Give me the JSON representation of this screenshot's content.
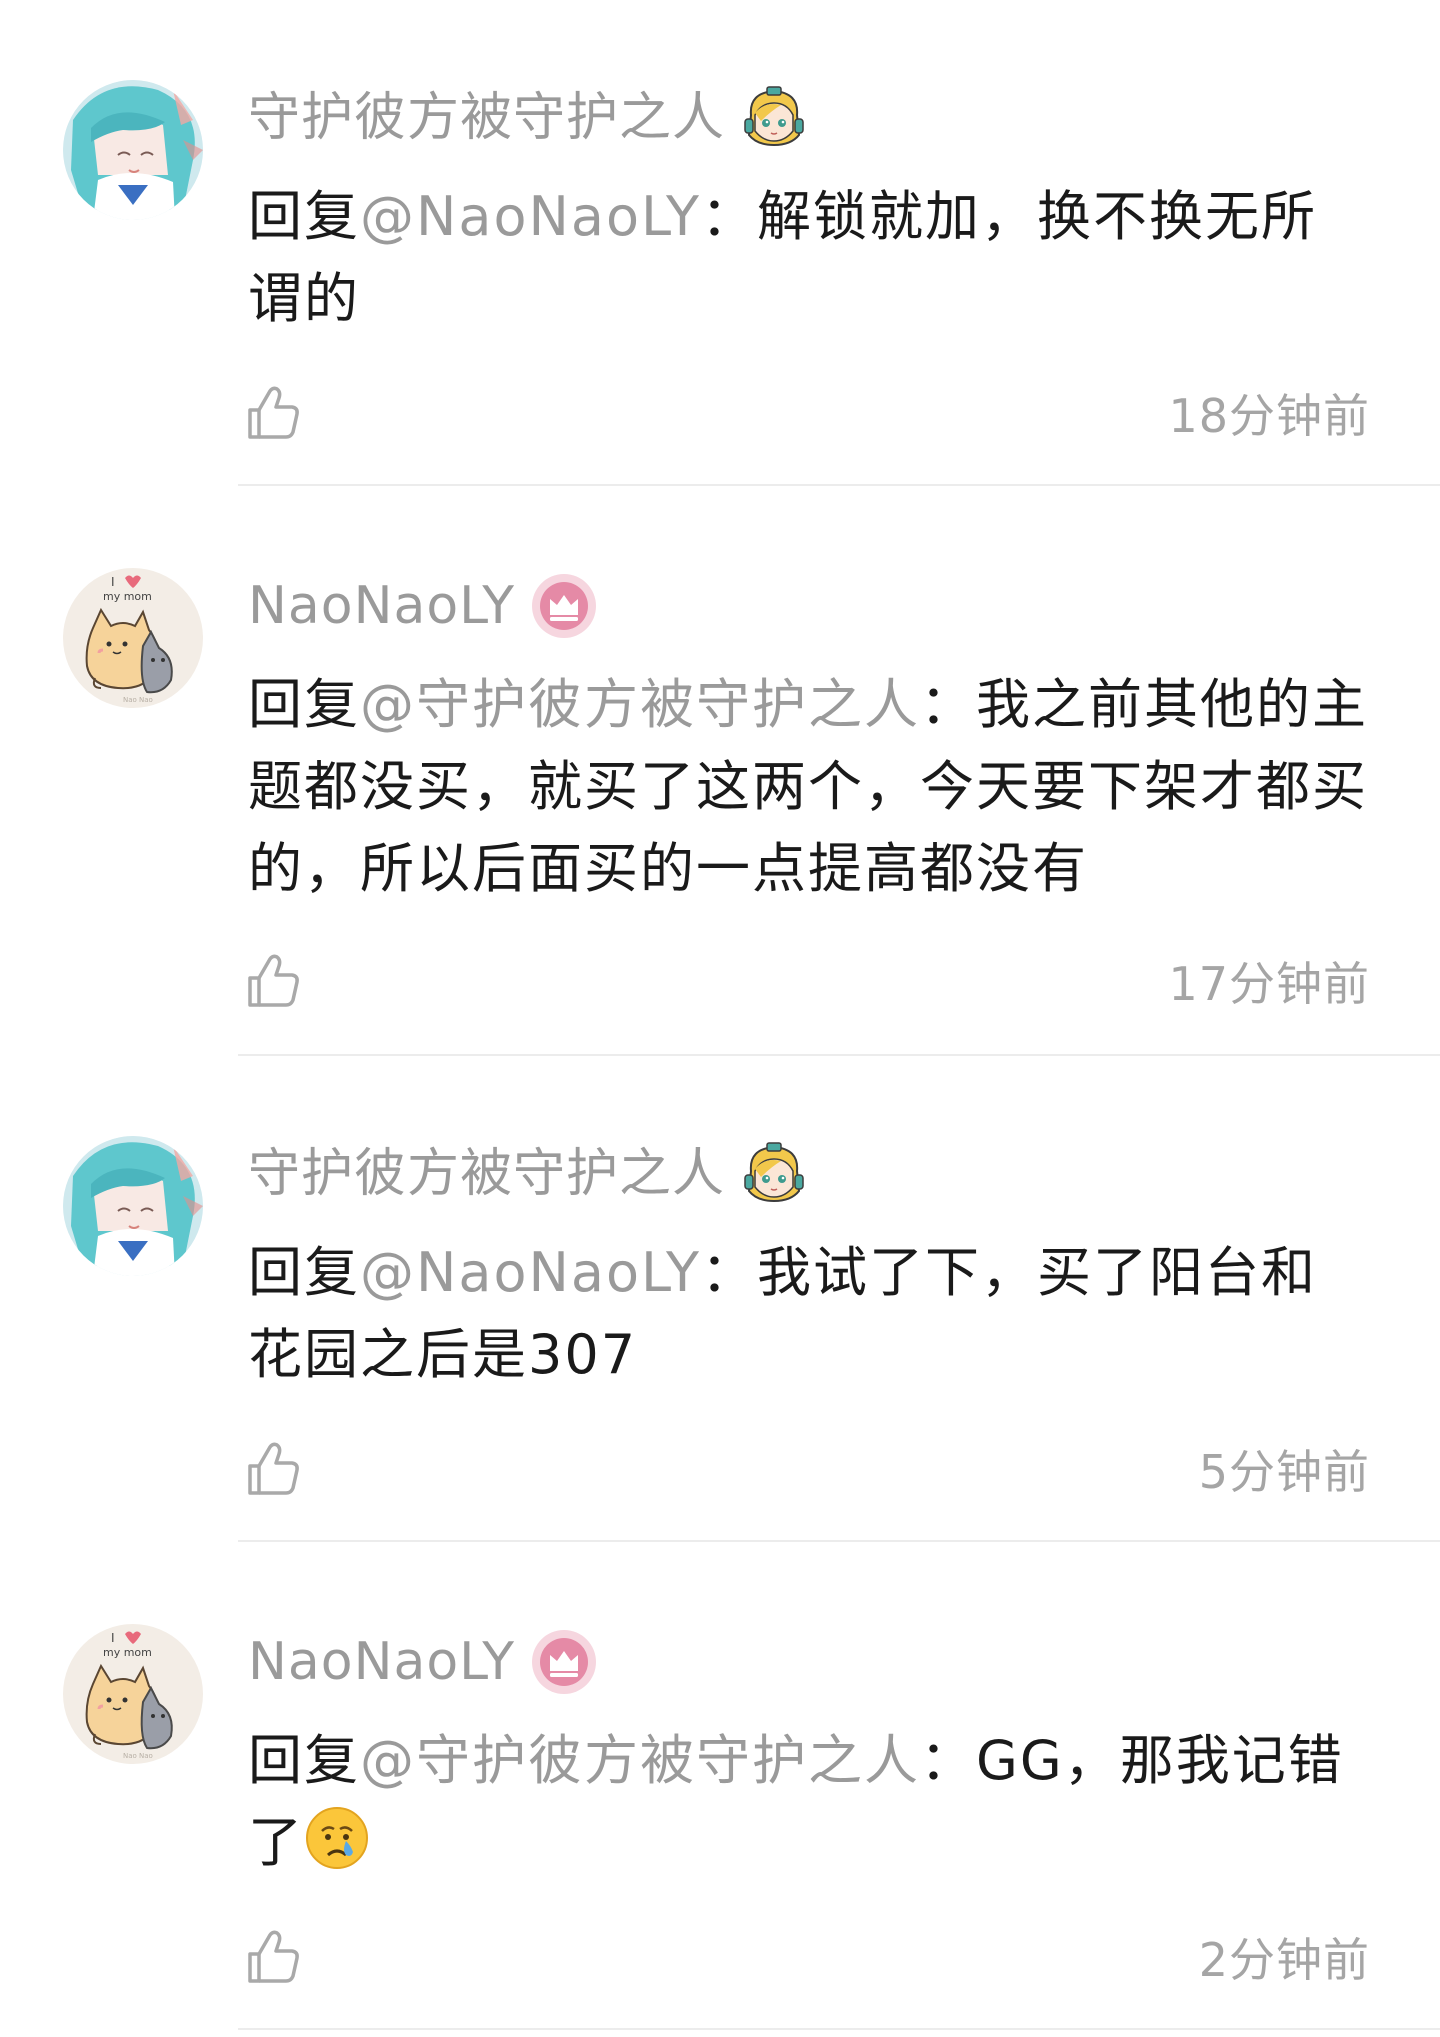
{
  "comments": [
    {
      "username": "守护彼方被守护之人",
      "badge_icon": "girl-avatar-badge-icon",
      "reply_prefix": "回复",
      "mention": "@NaoNaoLY",
      "separator": "：",
      "content": "解锁就加，换不换无所谓的",
      "like_icon": "thumbs-up-icon",
      "time": "18分钟前"
    },
    {
      "username": "NaoNaoLY",
      "badge_icon": "crown-badge-icon",
      "reply_prefix": "回复",
      "mention": "@守护彼方被守护之人",
      "separator": "：",
      "content": "我之前其他的主题都没买，就买了这两个，今天要下架才都买的，所以后面买的一点提高都没有",
      "like_icon": "thumbs-up-icon",
      "time": "17分钟前"
    },
    {
      "username": "守护彼方被守护之人",
      "badge_icon": "girl-avatar-badge-icon",
      "reply_prefix": "回复",
      "mention": "@NaoNaoLY",
      "separator": "：",
      "content": "我试了下，买了阳台和花园之后是307",
      "like_icon": "thumbs-up-icon",
      "time": "5分钟前"
    },
    {
      "username": "NaoNaoLY",
      "badge_icon": "crown-badge-icon",
      "reply_prefix": "回复",
      "mention": "@守护彼方被守护之人",
      "separator": "：",
      "content": "GG，那我记错了",
      "content_emoji": "crying-face-emoji",
      "like_icon": "thumbs-up-icon",
      "time": "2分钟前"
    }
  ],
  "colors": {
    "username": "#9a9a9a",
    "mention": "#9a9a9a",
    "text": "#1a1a1a",
    "time": "#a5a5a5",
    "divider": "#ececec",
    "crown_badge": "#e58aa6"
  }
}
